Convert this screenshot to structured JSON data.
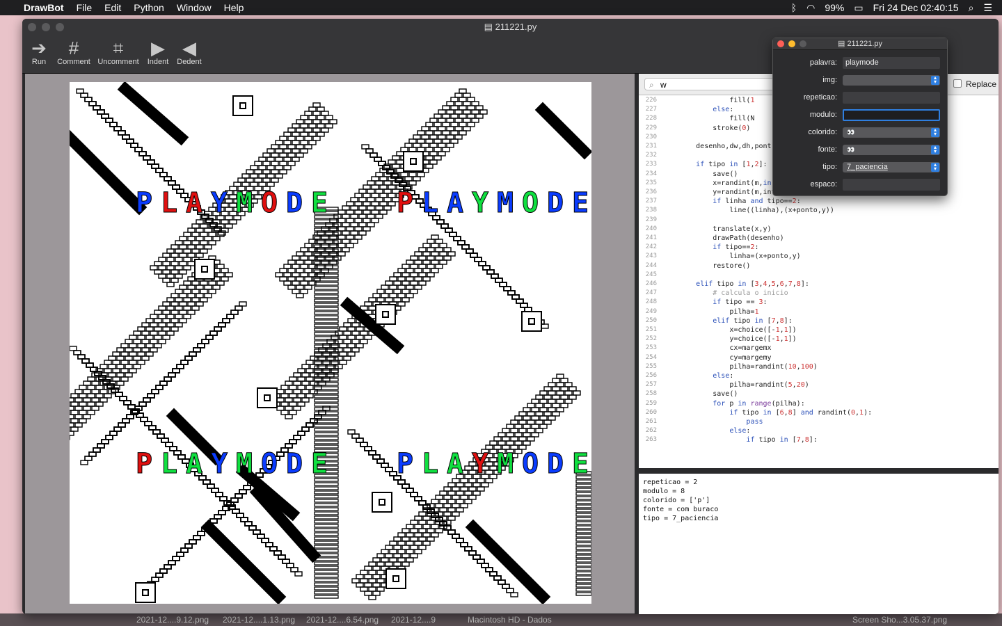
{
  "menubar": {
    "app": "DrawBot",
    "items": [
      "File",
      "Edit",
      "Python",
      "Window",
      "Help"
    ],
    "battery": "99%",
    "clock": "Fri 24 Dec  02:40:15"
  },
  "window": {
    "title": "211221.py",
    "toolbar": [
      "Run",
      "Comment",
      "Uncomment",
      "Indent",
      "Dedent"
    ]
  },
  "search": {
    "value": "w",
    "replace_label": "Replace"
  },
  "code": {
    "lines": [
      {
        "n": "226",
        "t": "                fill(1"
      },
      {
        "n": "227",
        "t": "            else:"
      },
      {
        "n": "228",
        "t": "                fill(N"
      },
      {
        "n": "229",
        "t": "            stroke(0)"
      },
      {
        "n": "230",
        "t": ""
      },
      {
        "n": "231",
        "t": "        desenho,dw,dh,pont"
      },
      {
        "n": "232",
        "t": ""
      },
      {
        "n": "233",
        "t": "        if tipo in [1,2]:"
      },
      {
        "n": "234",
        "t": "            save()"
      },
      {
        "n": "235",
        "t": "            x=randint(m,in"
      },
      {
        "n": "236",
        "t": "            y=randint(m,int"
      },
      {
        "n": "237",
        "t": "            if linha and tipo==2:"
      },
      {
        "n": "238",
        "t": "                line((linha),(x+ponto,y))"
      },
      {
        "n": "239",
        "t": ""
      },
      {
        "n": "240",
        "t": "            translate(x,y)"
      },
      {
        "n": "241",
        "t": "            drawPath(desenho)"
      },
      {
        "n": "242",
        "t": "            if tipo==2:"
      },
      {
        "n": "243",
        "t": "                linha=(x+ponto,y)"
      },
      {
        "n": "244",
        "t": "            restore()"
      },
      {
        "n": "245",
        "t": ""
      },
      {
        "n": "246",
        "t": "        elif tipo in [3,4,5,6,7,8]:"
      },
      {
        "n": "247",
        "t": "            # calcula o inicio"
      },
      {
        "n": "248",
        "t": "            if tipo == 3:"
      },
      {
        "n": "249",
        "t": "                pilha=1"
      },
      {
        "n": "250",
        "t": "            elif tipo in [7,8]:"
      },
      {
        "n": "251",
        "t": "                x=choice([-1,1])"
      },
      {
        "n": "252",
        "t": "                y=choice([-1,1])"
      },
      {
        "n": "253",
        "t": "                cx=margemx"
      },
      {
        "n": "254",
        "t": "                cy=margemy"
      },
      {
        "n": "255",
        "t": "                pilha=randint(10,100)"
      },
      {
        "n": "256",
        "t": "            else:"
      },
      {
        "n": "257",
        "t": "                pilha=randint(5,20)"
      },
      {
        "n": "258",
        "t": "            save()"
      },
      {
        "n": "259",
        "t": "            for p in range(pilha):"
      },
      {
        "n": "260",
        "t": "                if tipo in [6,8] and randint(0,1):"
      },
      {
        "n": "261",
        "t": "                    pass"
      },
      {
        "n": "262",
        "t": "                else:"
      },
      {
        "n": "263",
        "t": "                    if tipo in [7,8]:"
      }
    ]
  },
  "output": "repeticao = 2\nmodulo = 8\ncolorido = ['p']\nfonte = com buraco\ntipo = 7_paciencia",
  "panel": {
    "title": "211221.py",
    "fields": [
      {
        "label": "palavra:",
        "value": "playmode",
        "kind": "text"
      },
      {
        "label": "img:",
        "value": "",
        "kind": "select"
      },
      {
        "label": "repeticao:",
        "value": "",
        "kind": "text"
      },
      {
        "label": "modulo:",
        "value": "",
        "kind": "active"
      },
      {
        "label": "colorido:",
        "value": "",
        "kind": "select-eyes"
      },
      {
        "label": "fonte:",
        "value": "",
        "kind": "select-eyes"
      },
      {
        "label": "tipo:",
        "value": "7_paciencia",
        "kind": "select"
      },
      {
        "label": "espaco:",
        "value": "",
        "kind": "text"
      }
    ]
  },
  "desktop": {
    "files": [
      "2021-12....9.12.png",
      "2021-12....1.13.png",
      "2021-12....6.54.png",
      "2021-12....9",
      "Macintosh HD - Dados",
      "Screen Sho...3.05.37.png"
    ]
  },
  "art": {
    "words": [
      {
        "text": "PLAYMODE",
        "colors": [
          "#0a3cff",
          "#e01010",
          "#e01010",
          "#0a3cff",
          "#10e040",
          "#e01010",
          "#0a3cff",
          "#10e040"
        ]
      },
      {
        "text": "PLAYMODE",
        "colors": [
          "#e01010",
          "#0a3cff",
          "#0a3cff",
          "#10e040",
          "#0a3cff",
          "#10e040",
          "#0a3cff",
          "#0a3cff"
        ]
      },
      {
        "text": "PLAYMODE",
        "colors": [
          "#e01010",
          "#10e040",
          "#10e040",
          "#0a3cff",
          "#10e040",
          "#0a3cff",
          "#0a3cff",
          "#10e040"
        ]
      },
      {
        "text": "PLAYMODE",
        "colors": [
          "#0a3cff",
          "#10e040",
          "#10e040",
          "#e01010",
          "#10e040",
          "#0a3cff",
          "#0a3cff",
          "#10e040"
        ]
      }
    ]
  }
}
